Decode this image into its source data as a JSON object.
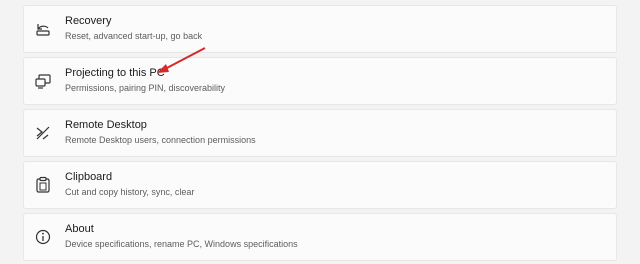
{
  "settings_items": [
    {
      "title": "Recovery",
      "description": "Reset, advanced start-up, go back",
      "icon": "recovery-icon"
    },
    {
      "title": "Projecting to this PC",
      "description": "Permissions, pairing PIN, discoverability",
      "icon": "projection-icon"
    },
    {
      "title": "Remote Desktop",
      "description": "Remote Desktop users, connection permissions",
      "icon": "remote-desktop-icon"
    },
    {
      "title": "Clipboard",
      "description": "Cut and copy history, sync, clear",
      "icon": "clipboard-icon"
    },
    {
      "title": "About",
      "description": "Device specifications, rename PC, Windows specifications",
      "icon": "info-icon"
    }
  ],
  "annotation": {
    "color": "#d42a2a",
    "icon": "red-arrow"
  }
}
